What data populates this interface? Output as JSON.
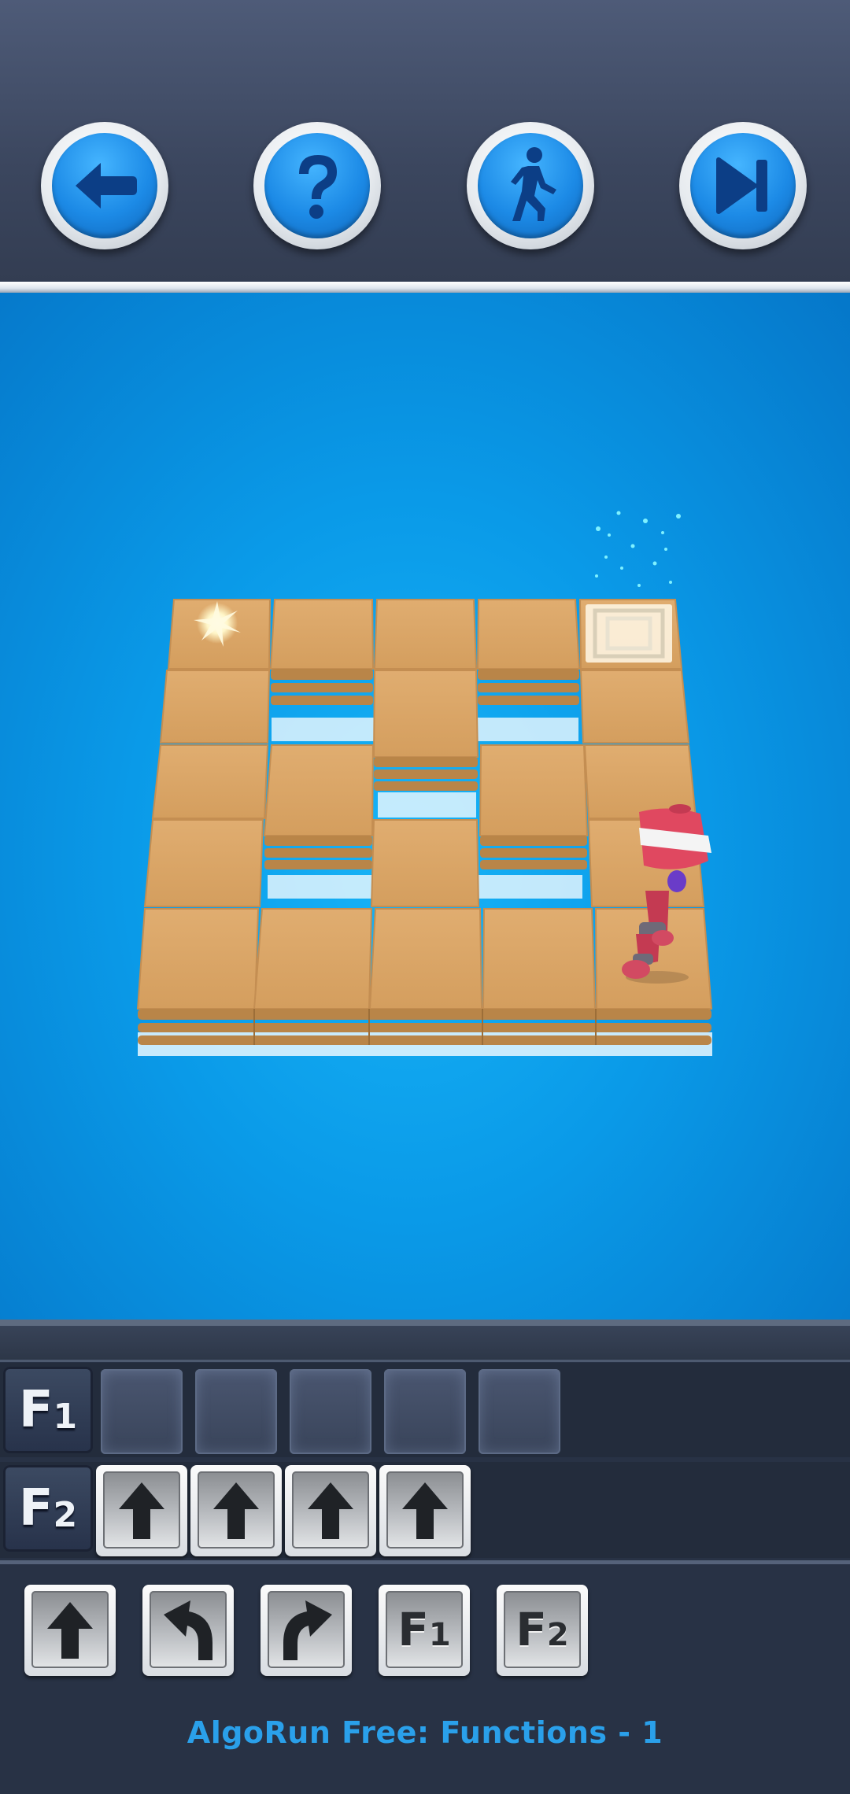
{
  "toolbar": {
    "buttons": [
      {
        "name": "back-button",
        "icon": "arrow-left-icon"
      },
      {
        "name": "help-button",
        "icon": "question-mark-icon"
      },
      {
        "name": "run-button",
        "icon": "walking-man-icon"
      },
      {
        "name": "skip-button",
        "icon": "skip-forward-icon"
      }
    ],
    "accent_color": "#1c8ae6"
  },
  "board": {
    "columns": 5,
    "rows": 5,
    "tile_color": "#d9a566",
    "background_color": "#0a9ae8",
    "goal_tile": "top-right",
    "spark_tile": "top-left",
    "robot_tile": "bottom-right"
  },
  "program": {
    "functions": [
      {
        "label": "F",
        "sub": "1",
        "slots": [
          "",
          "",
          "",
          "",
          ""
        ]
      },
      {
        "label": "F",
        "sub": "2",
        "slots": [
          "forward",
          "forward",
          "forward",
          "forward"
        ]
      }
    ]
  },
  "palette": [
    {
      "command": "forward",
      "icon": "arrow-up-icon"
    },
    {
      "command": "turn-left",
      "icon": "turn-left-icon"
    },
    {
      "command": "turn-right",
      "icon": "turn-right-icon"
    },
    {
      "command": "call-f1",
      "label": "F",
      "sub": "1"
    },
    {
      "command": "call-f2",
      "label": "F",
      "sub": "2"
    }
  ],
  "level_title": "AlgoRun Free: Functions - 1"
}
